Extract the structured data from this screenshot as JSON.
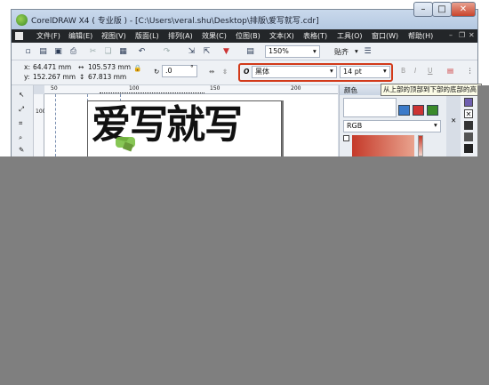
{
  "window": {
    "title": "CorelDRAW X4 ( 专业版 ) - [C:\\Users\\veral.shu\\Desktop\\排版\\爱写就写.cdr]",
    "min_glyph": "–",
    "max_glyph": "□",
    "close_glyph": "✕"
  },
  "menu": [
    "文件(F)",
    "编辑(E)",
    "视图(V)",
    "版面(L)",
    "排列(A)",
    "效果(C)",
    "位图(B)",
    "文本(X)",
    "表格(T)",
    "工具(O)",
    "窗口(W)",
    "帮助(H)"
  ],
  "toolbar": {
    "zoom_value": "150%",
    "align_label": "贴齐"
  },
  "property_bar": {
    "x_label": "x:",
    "x_value": "64.471 mm",
    "y_label": "y:",
    "y_value": "152.267 mm",
    "width_value": "105.573 mm",
    "height_value": "67.813 mm",
    "rotation_value": ".0",
    "degree_symbol": "°",
    "font_name": "黑体",
    "font_size": "14 pt"
  },
  "tooltip": "从上部的顶部到下部的底部的高",
  "ruler": {
    "ticks": [
      "50",
      "100",
      "150",
      "200"
    ],
    "v_tick": "100"
  },
  "color_panel": {
    "title": "颜色",
    "model": "RGB"
  },
  "canvas_text": "爱写就写",
  "colors": {
    "menubar_bg": "#232629",
    "highlight_red": "#d23a1a",
    "overlay_gray": "#7f7f7f",
    "accent_green": "#7ac043"
  }
}
